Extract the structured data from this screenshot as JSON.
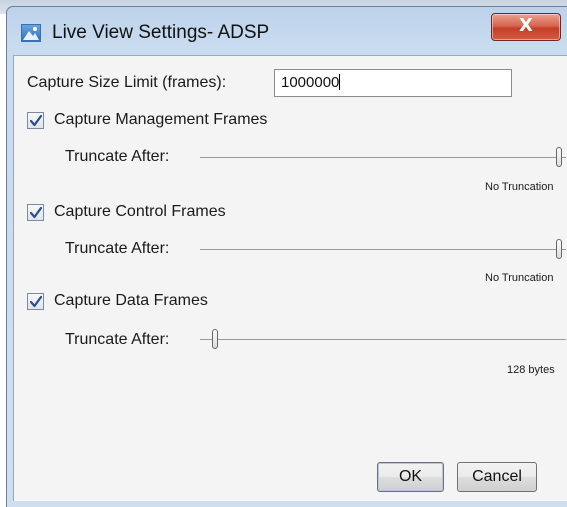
{
  "window": {
    "title": "Live View Settings- ADSP",
    "close_glyph": "X"
  },
  "form": {
    "capture_size_label": "Capture Size Limit (frames):",
    "capture_size_value": "1000000",
    "sections": [
      {
        "label": "Capture Management Frames",
        "checked": true,
        "truncate_label": "Truncate After:",
        "truncate_value_text": "No Truncation",
        "slider_position_fraction": 1.0
      },
      {
        "label": "Capture Control Frames",
        "checked": true,
        "truncate_label": "Truncate After:",
        "truncate_value_text": "No Truncation",
        "slider_position_fraction": 1.0
      },
      {
        "label": "Capture Data Frames",
        "checked": true,
        "truncate_label": "Truncate After:",
        "truncate_value_text": "128 bytes",
        "slider_position_fraction": 0.03
      }
    ]
  },
  "buttons": {
    "ok": "OK",
    "cancel": "Cancel"
  },
  "colors": {
    "titlebar": "#c9dbef",
    "close_button": "#c9472f",
    "dialog_body": "#f4f4f4",
    "checkmark": "#2b4f8c"
  },
  "icons": {
    "app": "image-icon",
    "close": "close-icon",
    "check": "checkmark-icon"
  }
}
